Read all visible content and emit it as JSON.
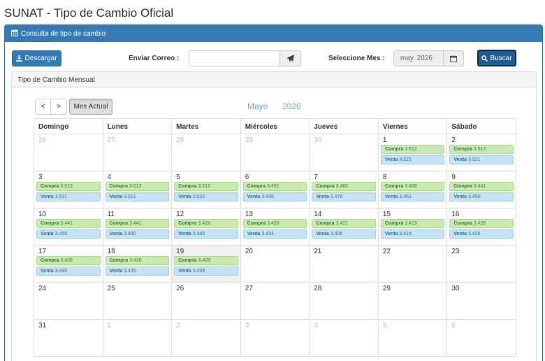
{
  "page": {
    "title": "SUNAT - Tipo de Cambio Oficial"
  },
  "panel": {
    "heading": "Consulta de tipo de cambio"
  },
  "toolbar": {
    "download_label": "Descargar",
    "email_label": "Enviar Correo :",
    "email_value": "",
    "month_label": "Seleccione Mes :",
    "month_value": "may. 2026",
    "search_label": "Buscar"
  },
  "subpanel": {
    "heading": "Tipo de Cambio Mensual"
  },
  "calendar": {
    "prev_label": "<",
    "next_label": ">",
    "today_label": "Mes Actual",
    "month": "Mayo",
    "year": "2026",
    "compra_label": "Compra",
    "venta_label": "Venta",
    "weekdays": [
      "Domingo",
      "Lunes",
      "Martes",
      "Miércoles",
      "Jueves",
      "Viernes",
      "Sábado"
    ],
    "weeks": [
      [
        {
          "day": "26",
          "other": true
        },
        {
          "day": "27",
          "other": true
        },
        {
          "day": "28",
          "other": true
        },
        {
          "day": "29",
          "other": true
        },
        {
          "day": "30",
          "other": true
        },
        {
          "day": "1",
          "compra": "3.512",
          "venta": "3.521"
        },
        {
          "day": "2",
          "compra": "3.512",
          "venta": "3.521"
        }
      ],
      [
        {
          "day": "3",
          "compra": "3.512",
          "venta": "3.521"
        },
        {
          "day": "4",
          "compra": "3.512",
          "venta": "3.521"
        },
        {
          "day": "5",
          "compra": "3.512",
          "venta": "3.522"
        },
        {
          "day": "6",
          "compra": "3.491",
          "venta": "3.498"
        },
        {
          "day": "7",
          "compra": "3.465",
          "venta": "3.470"
        },
        {
          "day": "8",
          "compra": "3.456",
          "venta": "3.461"
        },
        {
          "day": "9",
          "compra": "3.441",
          "venta": "3.450"
        }
      ],
      [
        {
          "day": "10",
          "compra": "3.441",
          "venta": "3.450"
        },
        {
          "day": "11",
          "compra": "3.441",
          "venta": "3.450"
        },
        {
          "day": "12",
          "compra": "3.428",
          "venta": "3.440"
        },
        {
          "day": "13",
          "compra": "3.428",
          "venta": "3.434"
        },
        {
          "day": "14",
          "compra": "3.421",
          "venta": "3.426"
        },
        {
          "day": "15",
          "compra": "3.413",
          "venta": "3.419"
        },
        {
          "day": "16",
          "compra": "3.426",
          "venta": "3.435"
        }
      ],
      [
        {
          "day": "17",
          "compra": "3.426",
          "venta": "3.435"
        },
        {
          "day": "18",
          "compra": "3.426",
          "venta": "3.435"
        },
        {
          "day": "19",
          "compra": "3.429",
          "venta": "3.439",
          "today": true
        },
        {
          "day": "20"
        },
        {
          "day": "21"
        },
        {
          "day": "22"
        },
        {
          "day": "23"
        }
      ],
      [
        {
          "day": "24"
        },
        {
          "day": "25"
        },
        {
          "day": "26"
        },
        {
          "day": "27"
        },
        {
          "day": "28"
        },
        {
          "day": "29"
        },
        {
          "day": "30"
        }
      ],
      [
        {
          "day": "31"
        },
        {
          "day": "1",
          "other": true
        },
        {
          "day": "2",
          "other": true
        },
        {
          "day": "3",
          "other": true
        },
        {
          "day": "4",
          "other": true
        },
        {
          "day": "5",
          "other": true
        },
        {
          "day": "6",
          "other": true
        }
      ]
    ]
  },
  "colors": {
    "primary": "#337ab7",
    "primary_dark": "#1e5c94",
    "compra_bg": "#c8ecb0",
    "venta_bg": "#c6e3f5",
    "title_accent": "#74a9d8"
  },
  "icons": {
    "heading": "calendar-icon",
    "download": "download-icon",
    "send": "paper-plane-icon",
    "month": "calendar-icon",
    "search": "search-icon"
  }
}
